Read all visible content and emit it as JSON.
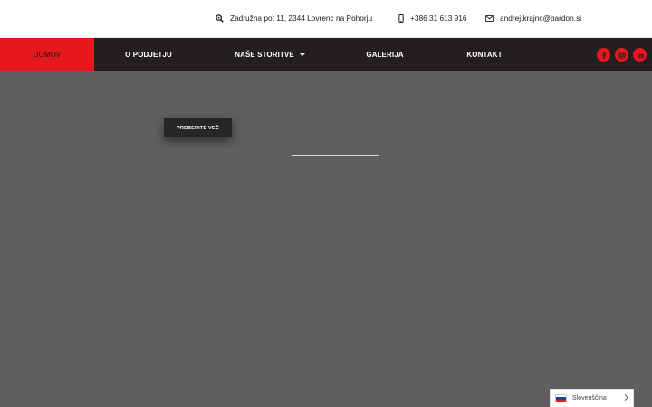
{
  "topbar": {
    "address": "Zadružna pot 11, 2344 Lovrenc na Pohorju",
    "phone": "+386 31 613 916",
    "email": "andrej.krajnc@bardon.si"
  },
  "nav": {
    "items": [
      {
        "label": "DOMOV",
        "active": true
      },
      {
        "label": "O PODJETJU"
      },
      {
        "label": "NAŠE STORITVE",
        "dropdown": true
      },
      {
        "label": "GALERIJA"
      },
      {
        "label": "KONTAKT"
      }
    ]
  },
  "social": {
    "icons": [
      "facebook-icon",
      "instagram-icon",
      "linkedin-icon"
    ]
  },
  "hero": {
    "cta_label": "PREBERITE VEČ"
  },
  "language": {
    "current": "Slovenščina"
  },
  "colors": {
    "accent": "#e5181e",
    "nav_bg": "#231f20",
    "hero_bg": "#5f5f5f",
    "button_bg": "#262626"
  }
}
